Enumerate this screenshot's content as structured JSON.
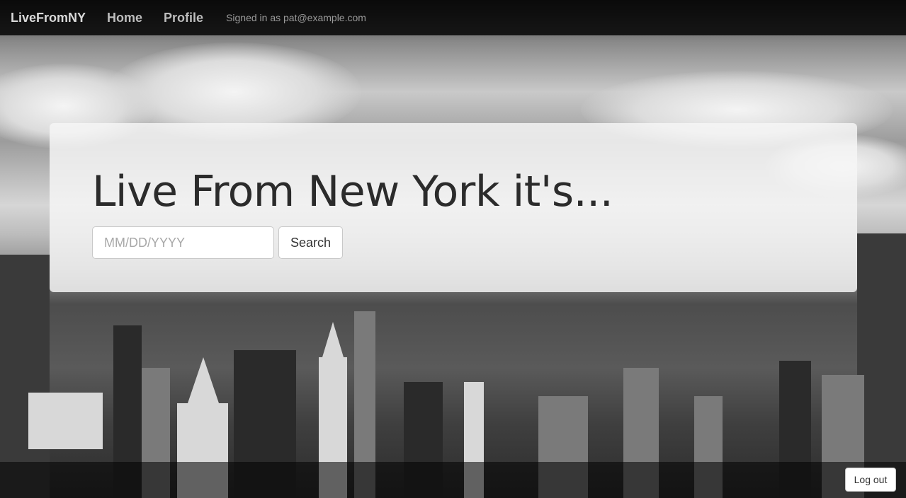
{
  "navbar": {
    "brand": "LiveFromNY",
    "links": [
      {
        "label": "Home"
      },
      {
        "label": "Profile"
      }
    ],
    "signed_in_text": "Signed in as pat@example.com"
  },
  "hero": {
    "title": "Live From New York it's...",
    "date_input": {
      "placeholder": "MM/DD/YYYY",
      "value": ""
    },
    "search_label": "Search"
  },
  "footer": {
    "logout_label": "Log out"
  },
  "colors": {
    "navbar_bg": "#0a0a0a",
    "panel_bg": "#f5f5f5",
    "title_text": "#2b2b2b",
    "button_bg": "#ffffff"
  }
}
